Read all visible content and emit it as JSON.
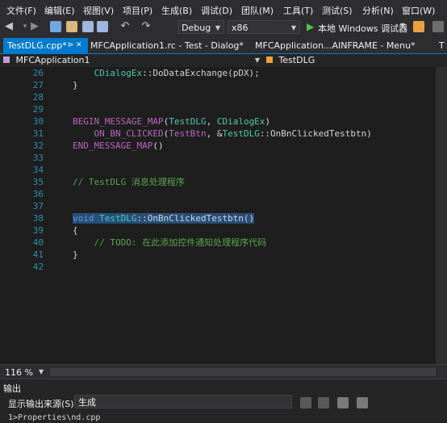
{
  "menu": [
    "文件(F)",
    "编辑(E)",
    "视图(V)",
    "项目(P)",
    "生成(B)",
    "调试(D)",
    "团队(M)",
    "工具(T)",
    "测试(S)",
    "分析(N)",
    "窗口(W)"
  ],
  "toolbar": {
    "config": "Debug",
    "platform": "x86",
    "run_label": "本地 Windows 调试器"
  },
  "tabs": [
    {
      "label": "TestDLG.cpp*",
      "pin": "⊳",
      "close": "✕"
    },
    {
      "label": "MFCApplication1.rc - Test - Dialog*"
    },
    {
      "label": "MFCApplication...AINFRAME - Menu*"
    },
    {
      "label": "T"
    }
  ],
  "nav": {
    "project": "MFCApplication1",
    "scope": "TestDLG"
  },
  "editor": {
    "lines": [
      {
        "num": "26",
        "html": "    <span class='cls'>CDialogEx</span>::DoDataExchange(pDX);"
      },
      {
        "num": "27",
        "html": "}"
      },
      {
        "num": "28",
        "html": ""
      },
      {
        "num": "29",
        "html": ""
      },
      {
        "num": "30",
        "html": "<span class='mac'>BEGIN_MESSAGE_MAP</span>(<span class='cls'>TestDLG</span>, <span class='cls'>CDialogEx</span>)"
      },
      {
        "num": "31",
        "html": "    <span class='mac'>ON_BN_CLICKED</span>(<span class='mac'>TestBtn</span>, &amp;<span class='cls'>TestDLG</span>::OnBnClickedTestbtn)"
      },
      {
        "num": "32",
        "html": "<span class='mac'>END_MESSAGE_MAP</span>()"
      },
      {
        "num": "33",
        "html": ""
      },
      {
        "num": "34",
        "html": ""
      },
      {
        "num": "35",
        "html": "<span class='cmt'>// TestDLG 消息处理程序</span>"
      },
      {
        "num": "36",
        "html": ""
      },
      {
        "num": "37",
        "html": ""
      },
      {
        "num": "38",
        "html": "<span class='sel'><span class='kw'>void</span> <span class='cls'>TestDLG</span>::OnBnClickedTestbtn()</span>"
      },
      {
        "num": "39",
        "html": "{"
      },
      {
        "num": "40",
        "html": "    <span class='cmt'>// TODO: 在此添加控件通知处理程序代码</span>"
      },
      {
        "num": "41",
        "html": "}"
      },
      {
        "num": "42",
        "html": ""
      }
    ]
  },
  "zoom": "116 %",
  "output": {
    "title": "输出",
    "source_label": "显示输出来源(S):",
    "source_value": "生成",
    "first_line": "1>Properties\\nd.cpp"
  },
  "colors": {
    "accent": "#007acc",
    "background": "#1e1e1e"
  }
}
